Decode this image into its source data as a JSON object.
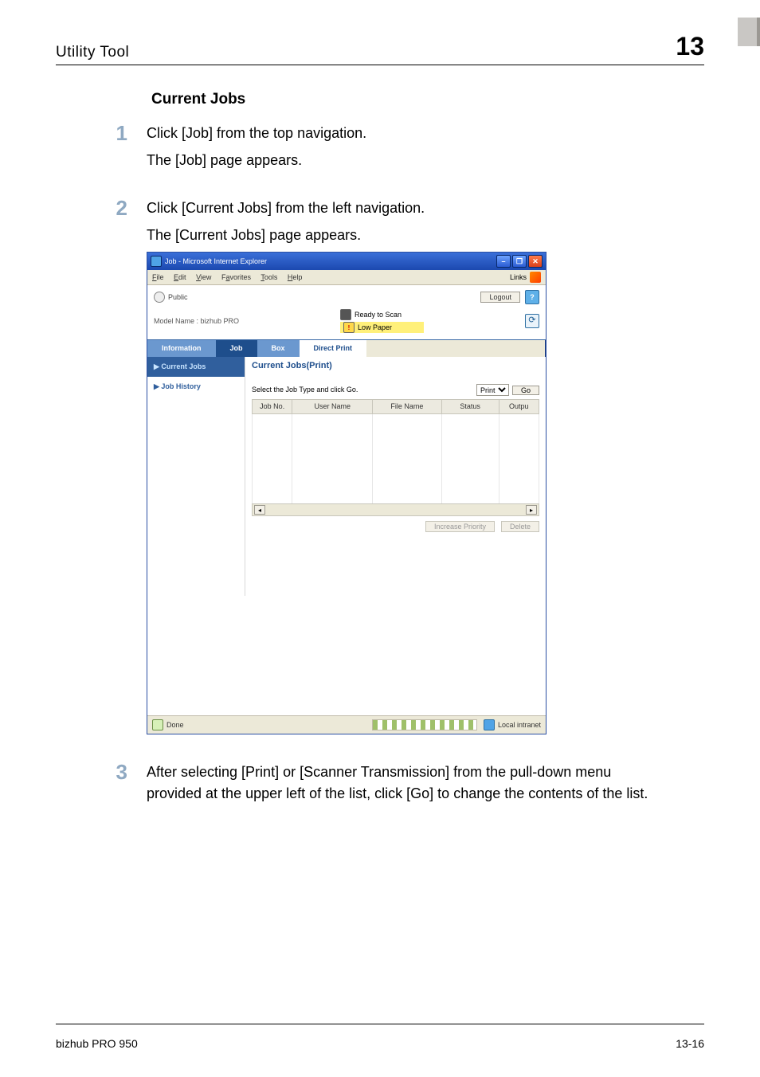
{
  "page": {
    "header_left": "Utility Tool",
    "header_right": "13",
    "section_title": "Current Jobs",
    "footer_left": "bizhub PRO 950",
    "footer_right": "13-16"
  },
  "steps": {
    "s1": {
      "num": "1",
      "line1": "Click [Job] from the top navigation.",
      "line2": "The [Job] page appears."
    },
    "s2": {
      "num": "2",
      "line1": "Click [Current Jobs] from the left navigation.",
      "line2": "The [Current Jobs] page appears."
    },
    "s3": {
      "num": "3",
      "line1": "After selecting [Print] or [Scanner Transmission] from the pull-down menu provided at the upper left of the list, click [Go] to change the contents of the list."
    }
  },
  "shot": {
    "title": "Job - Microsoft Internet Explorer",
    "menus": {
      "file": "File",
      "edit": "Edit",
      "view": "View",
      "favorites": "Favorites",
      "tools": "Tools",
      "help": "Help"
    },
    "links_label": "Links",
    "winbtns": {
      "min": "–",
      "max": "❐",
      "close": "✕"
    },
    "public_label": "Public",
    "logout": "Logout",
    "help_q": "?",
    "model_name": "Model Name : bizhub PRO",
    "status_scan": "Ready to Scan",
    "status_paper": "Low Paper",
    "refresh_glyph": "⟳",
    "tabs": {
      "info": "Information",
      "job": "Job",
      "box": "Box",
      "direct": "Direct Print"
    },
    "sidebar": {
      "current": "▶ Current Jobs",
      "history": "▶ Job History"
    },
    "content_title": "Current Jobs(Print)",
    "select_label": "Select the Job Type and click Go.",
    "select_value": "Print",
    "go": "Go",
    "table": {
      "c1": "Job No.",
      "c2": "User Name",
      "c3": "File Name",
      "c4": "Status",
      "c5": "Outpu"
    },
    "scroll": {
      "left": "◂",
      "right": "▸"
    },
    "btn_priority": "Increase Priority",
    "btn_delete": "Delete",
    "status_done": "Done",
    "status_zone": "Local intranet"
  }
}
